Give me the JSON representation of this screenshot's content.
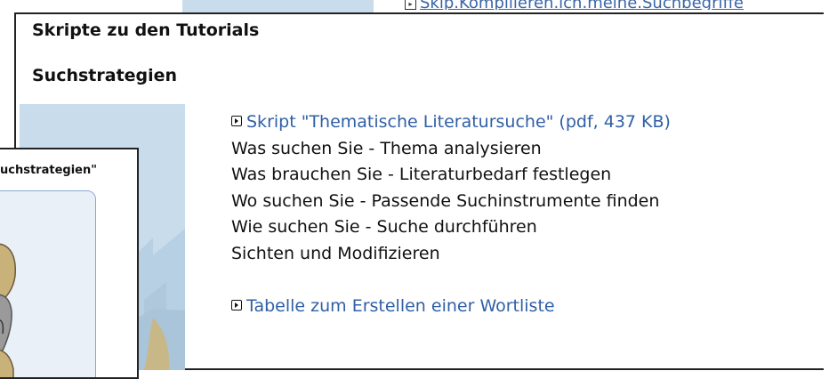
{
  "background": {
    "link_fragment": "Skip.Kompilieren.ich.meine.Suchbegriffe"
  },
  "popup": {
    "title": "Skripte zu den Tutorials",
    "section_title": "Suchstrategien",
    "script_link": "Skript \"Thematische Literatursuche\" (pdf, 437 KB)",
    "items": [
      "Was suchen Sie - Thema analysieren",
      "Was brauchen Sie - Literaturbedarf festlegen",
      "Wo suchen Sie - Passende Suchinstrumente finden",
      "Wie suchen Sie - Suche durchführen",
      "Sichten und Modifizieren"
    ],
    "table_link": "Tabelle zum Erstellen einer Wortliste"
  },
  "popup2": {
    "title": "uchstrategien\""
  },
  "colors": {
    "link": "#2f5fa6",
    "illustration_bg": "#c8dcec",
    "card_border": "#8aa6d2"
  },
  "icons": [
    "bullet-arrow-icon"
  ]
}
